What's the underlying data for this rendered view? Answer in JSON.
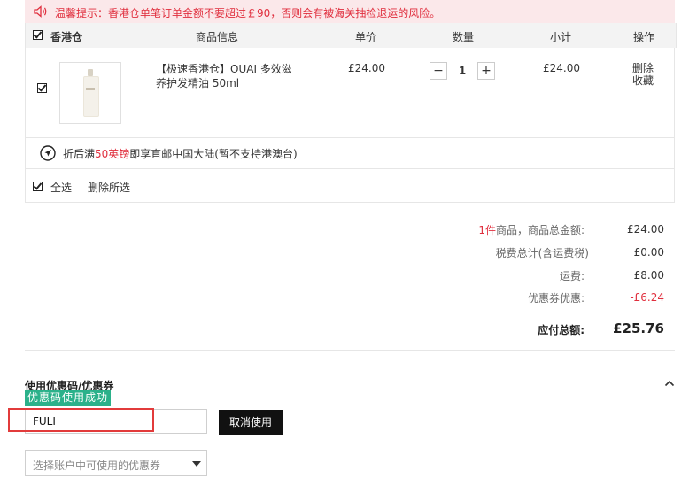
{
  "notice": {
    "text": "温馨提示：香港仓单笔订单金额不要超过￡90，否则会有被海关抽检退运的风险。"
  },
  "cart": {
    "warehouse_label": "香港仓",
    "headers": {
      "product_info": "商品信息",
      "unit_price": "单价",
      "quantity": "数量",
      "subtotal": "小计",
      "operation": "操作"
    },
    "items": [
      {
        "name": "【极速香港仓】OUAI 多效滋养护发精油 50ml",
        "unit_price": "£24.00",
        "quantity": "1",
        "subtotal": "£24.00",
        "delete_label": "删除",
        "favorite_label": "收藏"
      }
    ],
    "qty_minus": "−",
    "qty_plus": "+",
    "shipping_note": {
      "prefix": "折后满",
      "highlight": "50英镑",
      "suffix": "即享直邮中国大陆(暂不支持港澳台)"
    },
    "select_all_label": "全选",
    "delete_selected_label": "删除所选"
  },
  "summary": {
    "count": "1件",
    "items_total_label": "商品，商品总金额:",
    "items_total": "£24.00",
    "tax_label": "税费总计(含运费税)",
    "tax": "£0.00",
    "shipping_label": "运费:",
    "shipping": "£8.00",
    "coupon_label": "优惠券优惠:",
    "coupon": "-£6.24",
    "grand_total_label": "应付总额:",
    "grand_total": "£25.76"
  },
  "coupon": {
    "title": "使用优惠码/优惠券",
    "success_badge": "优惠码使用成功",
    "code_value": "FULI",
    "cancel_label": "取消使用",
    "select_placeholder": "选择账户中可使用的优惠券"
  },
  "colors": {
    "accent_red": "#e02e3d",
    "success_green": "#2bb18a",
    "notice_bg": "#fbe8ea"
  }
}
